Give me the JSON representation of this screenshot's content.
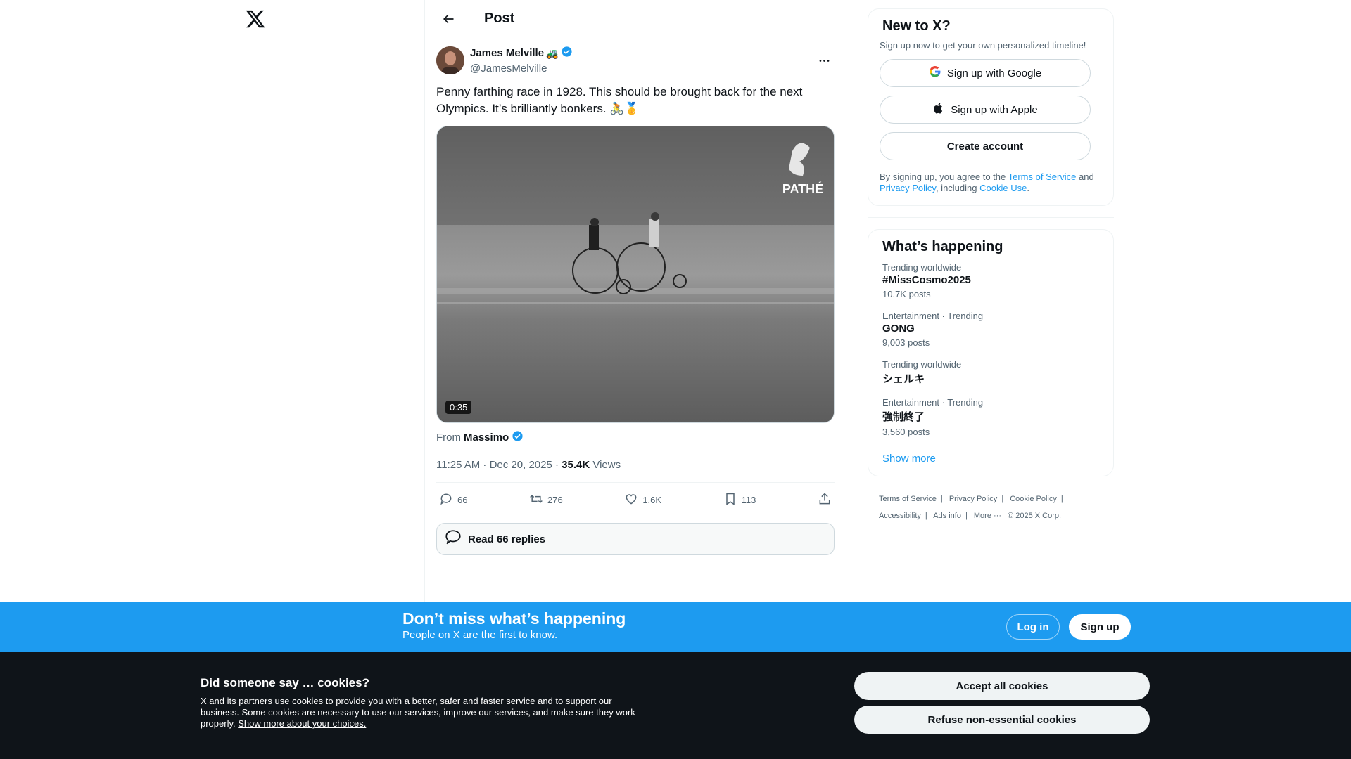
{
  "header": {
    "title": "Post"
  },
  "tweet": {
    "display_name": "James Melville",
    "name_emoji": "🚜",
    "handle": "@JamesMelville",
    "text": "Penny farthing race in 1928. This should be brought back for the next Olympics. It’s brilliantly bonkers. 🚴🥇",
    "video_duration": "0:35",
    "video_watermark": "PATHÉ",
    "from_label": "From",
    "from_source": "Massimo",
    "timestamp": "11:25 AM · Dec 20, 2025 · ",
    "views_count": "35.4K",
    "views_label": " Views",
    "replies": "66",
    "reposts": "276",
    "likes": "1.6K",
    "bookmarks": "113",
    "read_replies": "Read 66 replies"
  },
  "signup_card": {
    "title": "New to X?",
    "subtitle": "Sign up now to get your own personalized timeline!",
    "google_label": "Sign up with Google",
    "apple_label": "Sign up with Apple",
    "create_label": "Create account",
    "legal_1": "By signing up, you agree to the ",
    "terms": "Terms of Service",
    "legal_2": " and ",
    "privacy": "Privacy Policy",
    "legal_3": ", including ",
    "cookie_use": "Cookie Use",
    "legal_4": "."
  },
  "trends": {
    "title": "What’s happening",
    "items": [
      {
        "context": "Trending worldwide",
        "name": "#MissCosmo2025",
        "count": "10.7K posts"
      },
      {
        "context": "Entertainment · Trending",
        "name": "GONG",
        "count": "9,003 posts"
      },
      {
        "context": "Trending worldwide",
        "name": "シェルキ",
        "count": ""
      },
      {
        "context": "Entertainment · Trending",
        "name": "強制終了",
        "count": "3,560 posts"
      }
    ],
    "show_more": "Show more"
  },
  "footer": {
    "links": [
      "Terms of Service",
      "|",
      "Privacy Policy",
      "|",
      "Cookie Policy",
      "|",
      "Accessibility",
      "|",
      "Ads info",
      "|",
      "More ···",
      "© 2025 X Corp."
    ]
  },
  "banner": {
    "title": "Don’t miss what’s happening",
    "subtitle": "People on X are the first to know.",
    "login": "Log in",
    "signup": "Sign up"
  },
  "cookies": {
    "title": "Did someone say … cookies?",
    "text": "X and its partners use cookies to provide you with a better, safer and faster service and to support our business. Some cookies are necessary to use our services, improve our services, and make sure they work properly. ",
    "link": "Show more about your choices.",
    "accept": "Accept all cookies",
    "refuse": "Refuse non-essential cookies"
  },
  "colors": {
    "accent": "#1d9bf0",
    "text": "#0f1419",
    "muted": "#536471",
    "cookie_bg": "#0f1419"
  }
}
